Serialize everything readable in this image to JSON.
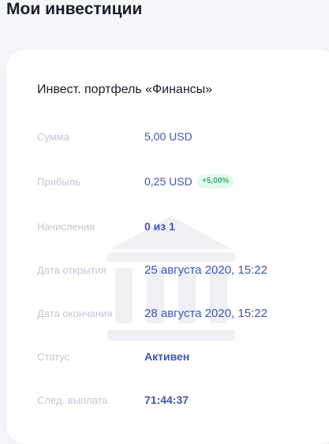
{
  "page": {
    "title": "Мои инвестиции"
  },
  "card": {
    "title": "Инвест. портфель «Финансы»",
    "watermark_icon": "bank-building-icon",
    "rows": [
      {
        "label": "Сумма",
        "value": "5,00 USD"
      },
      {
        "label": "Прибыль",
        "value": "0,25 USD",
        "badge": "+5,00%"
      },
      {
        "label": "Начисления",
        "value": "0 из 1"
      },
      {
        "label": "Дата открытия",
        "value": "25 августа 2020, 15:22"
      },
      {
        "label": "Дата окончания",
        "value": "28 августа 2020, 15:22"
      },
      {
        "label": "Статус",
        "value": "Активен"
      },
      {
        "label": "След. выплата",
        "value": "71:44:37"
      }
    ]
  },
  "colors": {
    "background": "#f6f7fb",
    "card": "#ffffff",
    "label": "#c3c7d6",
    "value": "#4054b2",
    "badge_bg": "#e5f8ee",
    "badge_text": "#3cb37a"
  }
}
